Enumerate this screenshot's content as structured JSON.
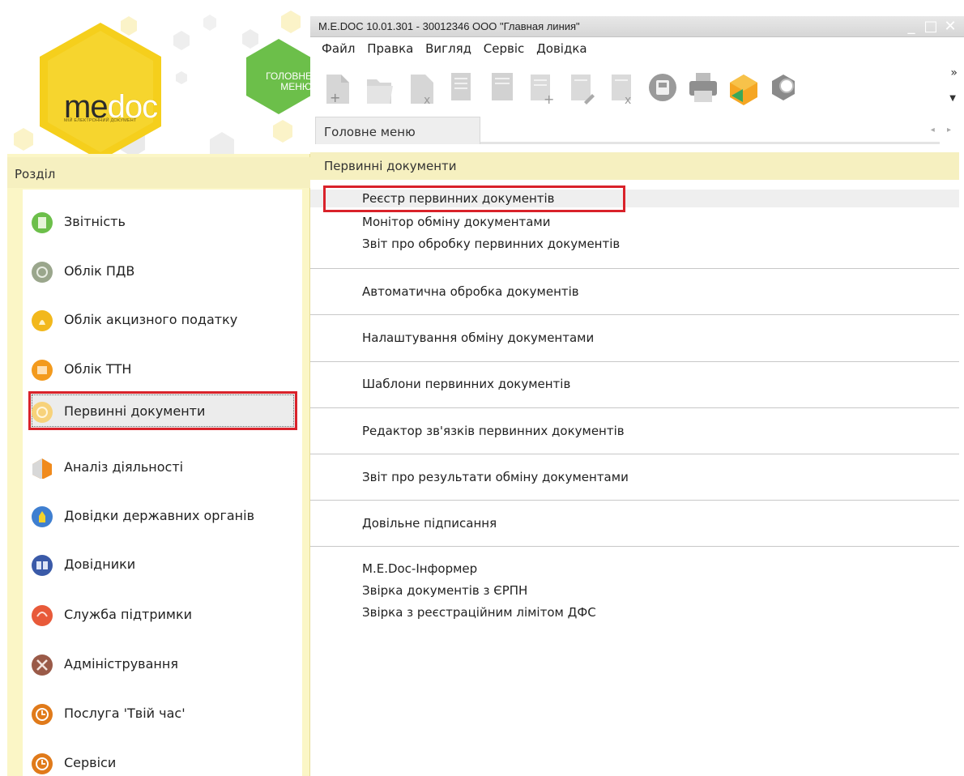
{
  "logo": {
    "me": "me",
    "doc": "doc",
    "subtitle": "МІЙ ЕЛЕКТРОННИЙ ДОКУМЕНТ",
    "main_menu_line1": "ГОЛОВНЕ",
    "main_menu_line2": "МЕНЮ"
  },
  "window": {
    "title": "M.E.DOC 10.01.301  - 30012346 ООО \"Главная линия\"",
    "minimize": "_",
    "maximize": "□",
    "close": "✕"
  },
  "menubar": {
    "items": [
      "Файл",
      "Правка",
      "Вигляд",
      "Сервіс",
      "Довідка"
    ]
  },
  "toolbar": {
    "more": "»",
    "dropdown": "▼",
    "buttons": [
      "new-document-icon",
      "open-folder-icon",
      "delete-document-icon",
      "copy-icon",
      "edit-icon",
      "add-row-icon",
      "edit-row-icon",
      "delete-row-icon",
      "save-disk-icon",
      "print-icon",
      "send-envelope-icon",
      "search-magnifier-icon"
    ]
  },
  "tabs": {
    "active": "Головне меню",
    "arrows": "◂ ▸"
  },
  "left_panel": {
    "header": "Розділ",
    "items": [
      {
        "label": "Звітність",
        "icon": "reports-icon",
        "color": "#6cbf4a"
      },
      {
        "label": "Облік ПДВ",
        "icon": "vat-icon",
        "color": "#9aa68c"
      },
      {
        "label": "Облік акцизного податку",
        "icon": "excise-icon",
        "color": "#f2b81c"
      },
      {
        "label": "Облік ТТН",
        "icon": "waybill-icon",
        "color": "#f39a1d"
      },
      {
        "label": "Первинні документи",
        "icon": "primary-docs-icon",
        "color": "#f7d27a",
        "selected": true
      },
      {
        "label": "Аналіз діяльності",
        "icon": "analysis-icon",
        "color": "#f08a1c"
      },
      {
        "label": "Довідки державних органів",
        "icon": "state-agencies-icon",
        "color": "#3f7fd0"
      },
      {
        "label": "Довідники",
        "icon": "handbooks-icon",
        "color": "#3a5aa8"
      },
      {
        "label": "Служба підтримки",
        "icon": "support-icon",
        "color": "#e85a3a"
      },
      {
        "label": "Адміністрування",
        "icon": "admin-tools-icon",
        "color": "#9a5a48"
      },
      {
        "label": "Послуга 'Твій час'",
        "icon": "your-time-icon",
        "color": "#e07a1a"
      },
      {
        "label": "Сервіси",
        "icon": "services-icon",
        "color": "#e07a1a"
      }
    ]
  },
  "content": {
    "header": "Первинні документи",
    "groups": [
      [
        "Реєстр первинних документів",
        "Монітор обміну документами",
        "Звіт про обробку первинних документів"
      ],
      [
        "Автоматична обробка документів"
      ],
      [
        "Налаштування обміну документами"
      ],
      [
        "Шаблони первинних документів"
      ],
      [
        "Редактор зв'язків первинних документів"
      ],
      [
        "Звіт про результати обміну документами"
      ],
      [
        "Довільне підписання"
      ],
      [
        "M.E.Doc-Інформер",
        "Звірка документів з ЄРПН",
        "Звірка з реєстраційним лімітом ДФС"
      ]
    ]
  }
}
